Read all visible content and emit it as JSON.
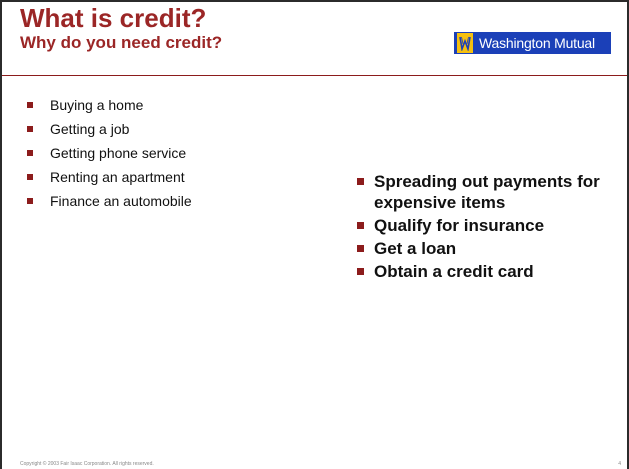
{
  "slide": {
    "title": "What is credit?",
    "subtitle": "Why do you need credit?",
    "logo_text": "Washington Mutual",
    "left_bullets": [
      "Buying a home",
      "Getting a job",
      "Getting phone service",
      "Renting an apartment",
      "Finance an automobile"
    ],
    "right_bullets": [
      "Spreading out payments for expensive items",
      "Qualify for insurance",
      "Get a loan",
      "Obtain a credit card"
    ],
    "copyright": "Copyright © 2003 Fair Isaac Corporation. All rights reserved.",
    "page_number": "4"
  },
  "colors": {
    "title": "#9b2626",
    "bullet": "#8c1c1c",
    "logo_bg": "#1b40b8",
    "logo_mark": "#f5c010"
  }
}
